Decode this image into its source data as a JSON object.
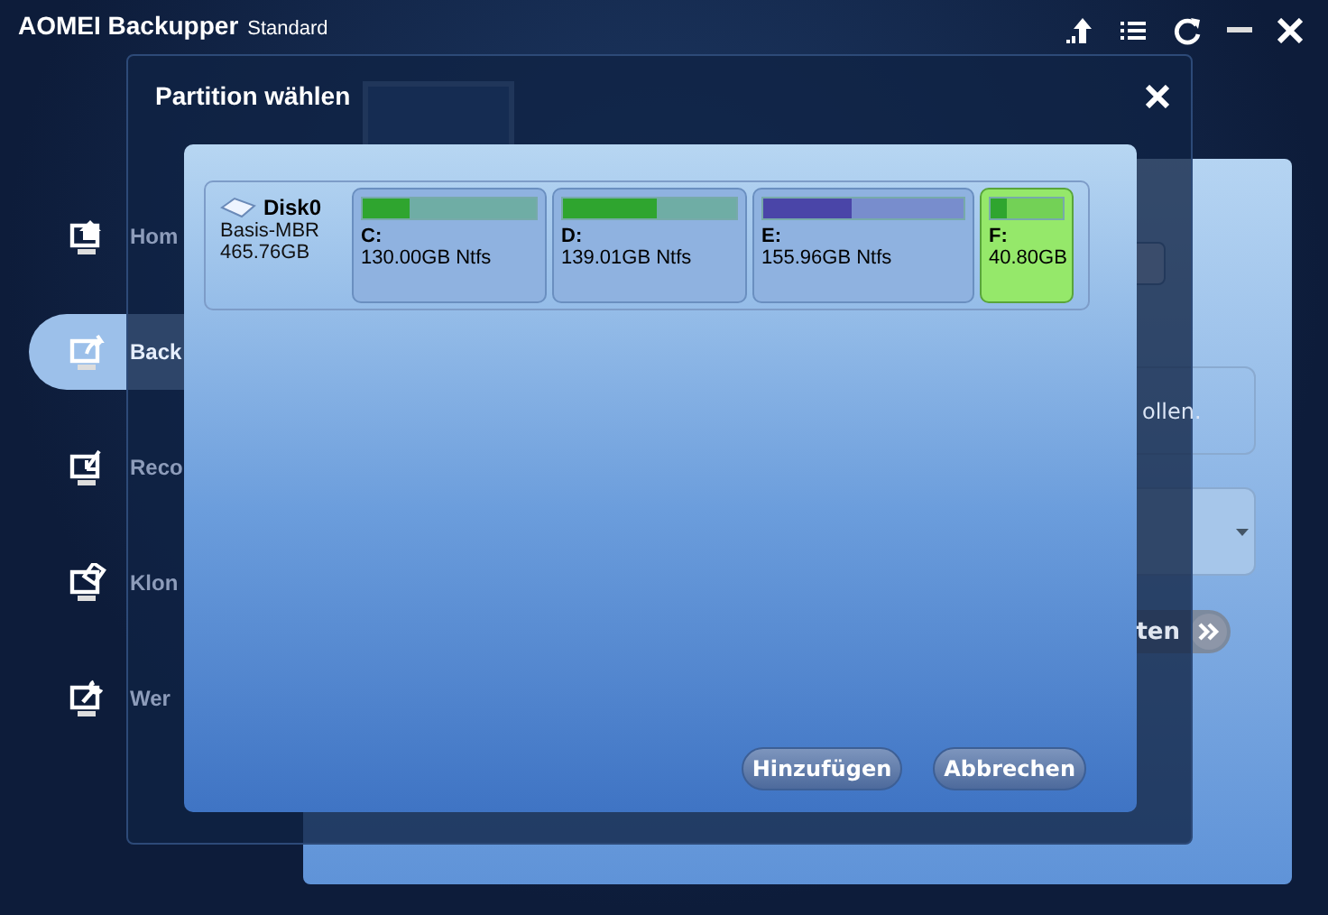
{
  "window": {
    "title": "AOMEI Backupper",
    "edition": "Standard"
  },
  "sidebar": {
    "items": [
      {
        "label": "Hom",
        "selected": false
      },
      {
        "label": "Back",
        "selected": true
      },
      {
        "label": "Reco",
        "selected": false
      },
      {
        "label": "Klon",
        "selected": false
      },
      {
        "label": "Wer",
        "selected": false
      }
    ]
  },
  "background_panel": {
    "note": "ollen.",
    "next_button": "ten"
  },
  "dialog": {
    "title": "Partition wählen",
    "disk": {
      "name": "Disk0",
      "type": "Basis-MBR",
      "size": "465.76GB"
    },
    "partitions": [
      {
        "letter": "C:",
        "info": "130.00GB Ntfs",
        "level": 0.27,
        "color": "#2fa52f",
        "selected": false
      },
      {
        "letter": "D:",
        "info": "139.01GB Ntfs",
        "level": 0.54,
        "color": "#2fa52f",
        "selected": false
      },
      {
        "letter": "E:",
        "info": "155.96GB Ntfs",
        "level": 0.44,
        "color": "#4a45a8",
        "selected": false
      },
      {
        "letter": "F:",
        "info": "40.80GB",
        "level": 0.22,
        "color": "#2fa52f",
        "selected": true
      }
    ],
    "buttons": [
      "Hinzufügen",
      "Abbrechen"
    ]
  }
}
